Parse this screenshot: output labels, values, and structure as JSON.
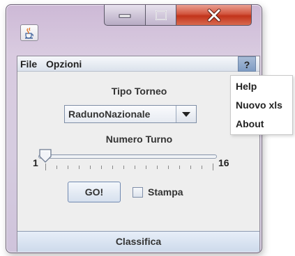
{
  "window": {
    "icon": "java-cup-icon",
    "controls": [
      "minimize",
      "maximize",
      "close"
    ]
  },
  "menubar": {
    "file": "File",
    "opzioni": "Opzioni",
    "help": "?"
  },
  "help_menu": {
    "items": [
      "Help",
      "Nuovo xls",
      "About"
    ]
  },
  "tipo_torneo": {
    "label": "Tipo Torneo",
    "selected": "RadunoNazionale"
  },
  "numero_turno": {
    "label": "Numero Turno",
    "min": "1",
    "max": "16",
    "value": 1
  },
  "actions": {
    "go": "GO!",
    "stampa": "Stampa",
    "stampa_checked": false,
    "classifica": "Classifica"
  }
}
